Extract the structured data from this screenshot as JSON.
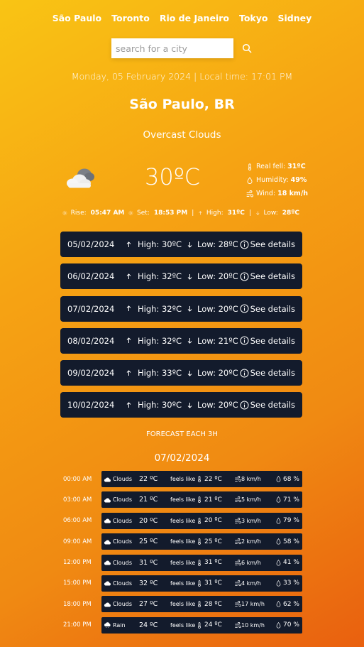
{
  "nav": [
    "São Paulo",
    "Toronto",
    "Rio de Janeiro",
    "Tokyo",
    "Sidney"
  ],
  "search": {
    "placeholder": "search for a city",
    "value": ""
  },
  "date_line": "Monday, 05 February 2024 | Local time: 17:01 PM",
  "city": "São Paulo, BR",
  "condition": "Overcast Clouds",
  "current": {
    "temp": "30ºC",
    "real_feel_label": "Real fell:",
    "real_feel": "31ºC",
    "humidity_label": "Humidity:",
    "humidity": "49%",
    "wind_label": "Wind:",
    "wind": "18 km/h"
  },
  "sun": {
    "rise_label": "Rise:",
    "rise": "05:47 AM",
    "set_label": "Set:",
    "set": "18:53 PM",
    "separator": "|",
    "high_label": "High:",
    "high": "31ºC",
    "low_label": "Low:",
    "low": "28ºC"
  },
  "daily": [
    {
      "date": "05/02/2024",
      "high": "High: 30ºC",
      "low": "Low: 28ºC",
      "action": "See details"
    },
    {
      "date": "06/02/2024",
      "high": "High: 32ºC",
      "low": "Low: 20ºC",
      "action": "See details"
    },
    {
      "date": "07/02/2024",
      "high": "High: 32ºC",
      "low": "Low: 20ºC",
      "action": "See details"
    },
    {
      "date": "08/02/2024",
      "high": "High: 32ºC",
      "low": "Low: 21ºC",
      "action": "See details"
    },
    {
      "date": "09/02/2024",
      "high": "High: 33ºC",
      "low": "Low: 20ºC",
      "action": "See details"
    },
    {
      "date": "10/02/2024",
      "high": "High: 30ºC",
      "low": "Low: 20ºC",
      "action": "See details"
    }
  ],
  "forecast_title": "FORECAST EACH 3H",
  "forecast_date": "07/02/2024",
  "feels_label": "feels like",
  "hourly": [
    {
      "time": "00:00 AM",
      "desc": "Clouds",
      "temp": "22 ºC",
      "feels": "22 ºC",
      "wind": "8 km/h",
      "humidity": "68 %"
    },
    {
      "time": "03:00 AM",
      "desc": "Clouds",
      "temp": "21 ºC",
      "feels": "21 ºC",
      "wind": "5 km/h",
      "humidity": "71 %"
    },
    {
      "time": "06:00 AM",
      "desc": "Clouds",
      "temp": "20 ºC",
      "feels": "20 ºC",
      "wind": "3 km/h",
      "humidity": "79 %"
    },
    {
      "time": "09:00 AM",
      "desc": "Clouds",
      "temp": "25 ºC",
      "feels": "25 ºC",
      "wind": "2 km/h",
      "humidity": "58 %"
    },
    {
      "time": "12:00 PM",
      "desc": "Clouds",
      "temp": "31 ºC",
      "feels": "31 ºC",
      "wind": "6 km/h",
      "humidity": "41 %"
    },
    {
      "time": "15:00 PM",
      "desc": "Clouds",
      "temp": "32 ºC",
      "feels": "31 ºC",
      "wind": "4 km/h",
      "humidity": "33 %"
    },
    {
      "time": "18:00 PM",
      "desc": "Clouds",
      "temp": "27 ºC",
      "feels": "28 ºC",
      "wind": "17 km/h",
      "humidity": "62 %"
    },
    {
      "time": "21:00 PM",
      "desc": "Rain",
      "temp": "24 ºC",
      "feels": "24 ºC",
      "wind": "10 km/h",
      "humidity": "70 %"
    }
  ],
  "colors": {
    "card": "#131b2c",
    "bg_top": "#f9c414",
    "bg_bottom": "#e9600f"
  },
  "icons": {
    "weather": "overcast-clouds-icon",
    "search": "search-icon",
    "thermometer": "thermometer-icon",
    "humidity": "droplet-icon",
    "wind": "wind-icon",
    "sunrise": "sun-icon",
    "up": "arrow-up-icon",
    "down": "arrow-down-icon",
    "info": "info-icon"
  }
}
